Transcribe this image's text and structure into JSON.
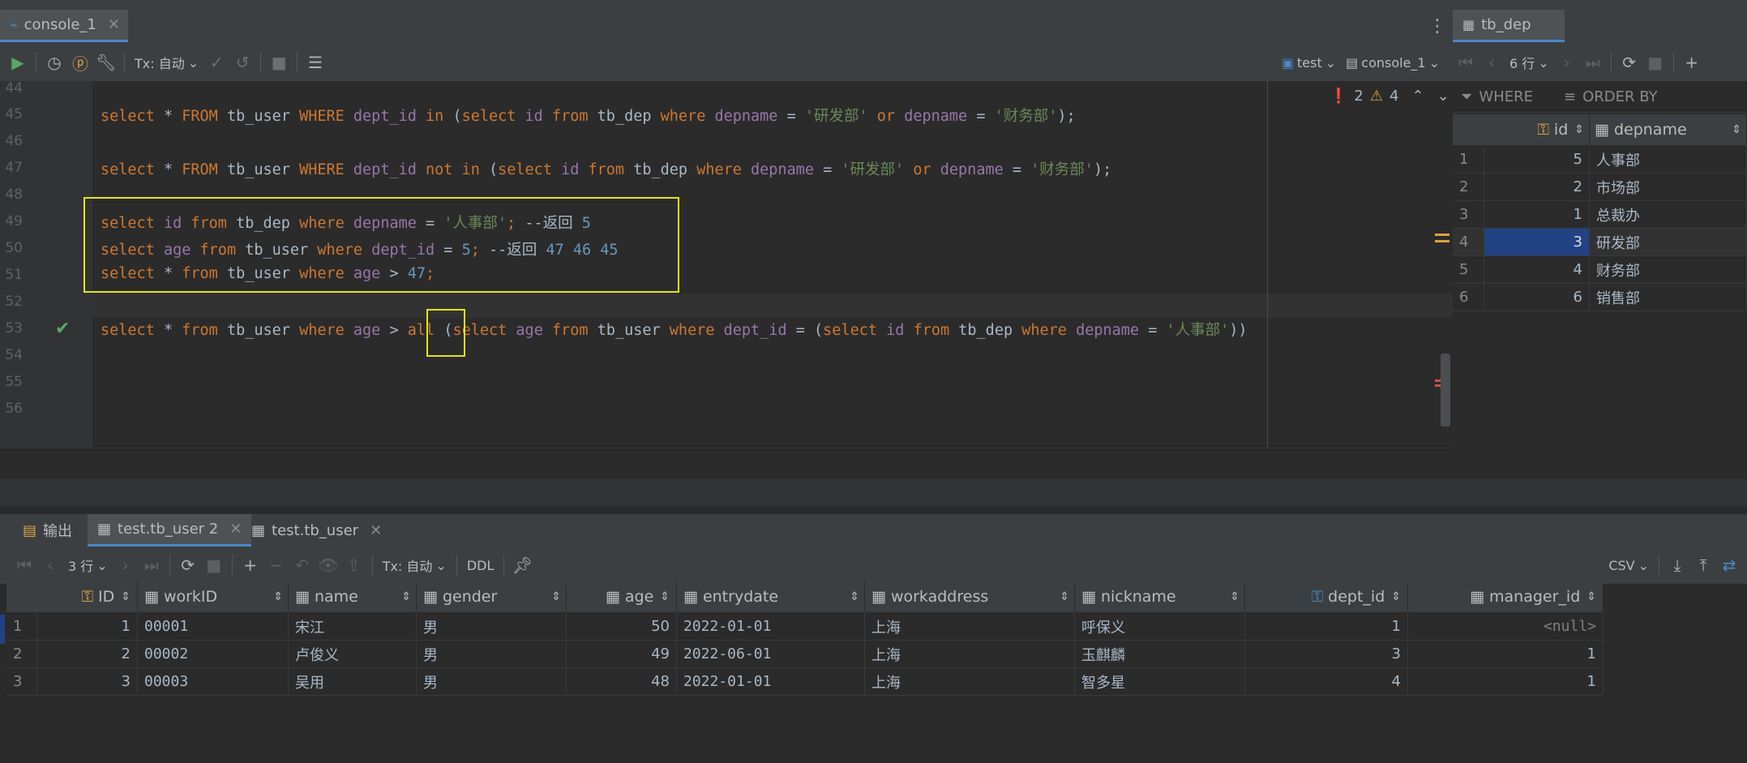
{
  "editor_tab": {
    "title": "console_1"
  },
  "right_tab": {
    "title": "tb_dep"
  },
  "toolbar": {
    "tx_label": "Tx: 自动",
    "datasource": "test",
    "console": "console_1"
  },
  "right_toolbar": {
    "rows_label": "6 行"
  },
  "inspection": {
    "errors": "2",
    "warnings": "4"
  },
  "filter": {
    "where": "WHERE",
    "order_by": "ORDER BY"
  },
  "lines": [
    {
      "n": "44"
    },
    {
      "n": "45"
    },
    {
      "n": "46"
    },
    {
      "n": "47"
    },
    {
      "n": "48"
    },
    {
      "n": "49"
    },
    {
      "n": "50"
    },
    {
      "n": "51"
    },
    {
      "n": "52"
    },
    {
      "n": "53"
    },
    {
      "n": "54"
    },
    {
      "n": "55"
    },
    {
      "n": "56"
    }
  ],
  "code": {
    "l45": [
      "select",
      "*",
      "FROM",
      "tb_user",
      "WHERE",
      "dept_id",
      "in",
      "(",
      "select",
      "id",
      "from",
      "tb_dep",
      "where",
      "depname",
      "=",
      "'研发部'",
      "or",
      "depname",
      "=",
      "'财务部'",
      ");"
    ],
    "l47": [
      "select",
      "*",
      "FROM",
      "tb_user",
      "WHERE",
      "dept_id",
      "not in",
      "(",
      "select",
      "id",
      "from",
      "tb_dep",
      "where",
      "depname",
      "=",
      "'研发部'",
      "or",
      "depname",
      "=",
      "'财务部'",
      ");"
    ],
    "l49": [
      "select",
      "id",
      "from",
      "tb_dep",
      "where",
      "depname",
      "=",
      "'人事部'",
      ";",
      "--返回",
      "5"
    ],
    "l50": [
      "select",
      "age",
      "from",
      "tb_user",
      "where",
      "dept_id",
      "=",
      "5",
      ";",
      "--返回",
      "47 46 45"
    ],
    "l51": [
      "select",
      "*",
      "from",
      "tb_user",
      "where",
      "age",
      ">",
      "47",
      ";"
    ],
    "l53": [
      "select",
      "*",
      "from",
      "tb_user",
      "where",
      "age",
      ">",
      "all",
      "(",
      "select",
      "age",
      "from",
      "tb_user",
      "where",
      "dept_id",
      "=",
      "(",
      "select",
      "id",
      "from",
      "tb_dep",
      "where",
      "depname",
      "=",
      "'人事部'",
      "))"
    ]
  },
  "dep_table": {
    "headers": [
      "id",
      "depname"
    ],
    "rows": [
      {
        "row": "1",
        "id": "5",
        "depname": "人事部"
      },
      {
        "row": "2",
        "id": "2",
        "depname": "市场部"
      },
      {
        "row": "3",
        "id": "1",
        "depname": "总裁办"
      },
      {
        "row": "4",
        "id": "3",
        "depname": "研发部"
      },
      {
        "row": "5",
        "id": "4",
        "depname": "财务部"
      },
      {
        "row": "6",
        "id": "6",
        "depname": "销售部"
      }
    ]
  },
  "bottom_tabs": {
    "output": "输出",
    "tab1": "test.tb_user 2",
    "tab2": "test.tb_user"
  },
  "bottom_toolbar": {
    "rows_label": "3 行",
    "tx_label": "Tx: 自动",
    "ddl": "DDL",
    "export": "CSV"
  },
  "user_table": {
    "headers": [
      "ID",
      "workID",
      "name",
      "gender",
      "age",
      "entrydate",
      "workaddress",
      "nickname",
      "dept_id",
      "manager_id"
    ],
    "rows": [
      {
        "row": "1",
        "ID": "1",
        "workID": "00001",
        "name": "宋江",
        "gender": "男",
        "age": "50",
        "entrydate": "2022-01-01",
        "workaddress": "上海",
        "nickname": "呼保义",
        "dept_id": "1",
        "manager_id": "<null>"
      },
      {
        "row": "2",
        "ID": "2",
        "workID": "00002",
        "name": "卢俊义",
        "gender": "男",
        "age": "49",
        "entrydate": "2022-06-01",
        "workaddress": "上海",
        "nickname": "玉麒麟",
        "dept_id": "3",
        "manager_id": "1"
      },
      {
        "row": "3",
        "ID": "3",
        "workID": "00003",
        "name": "吴用",
        "gender": "男",
        "age": "48",
        "entrydate": "2022-01-01",
        "workaddress": "上海",
        "nickname": "智多星",
        "dept_id": "4",
        "manager_id": "1"
      }
    ]
  },
  "colors": {
    "keyword": "#cc7832",
    "identifier": "#9876aa",
    "string": "#6a8759",
    "number": "#6897bb",
    "highlight": "#e5e511",
    "selection": "#214283"
  }
}
